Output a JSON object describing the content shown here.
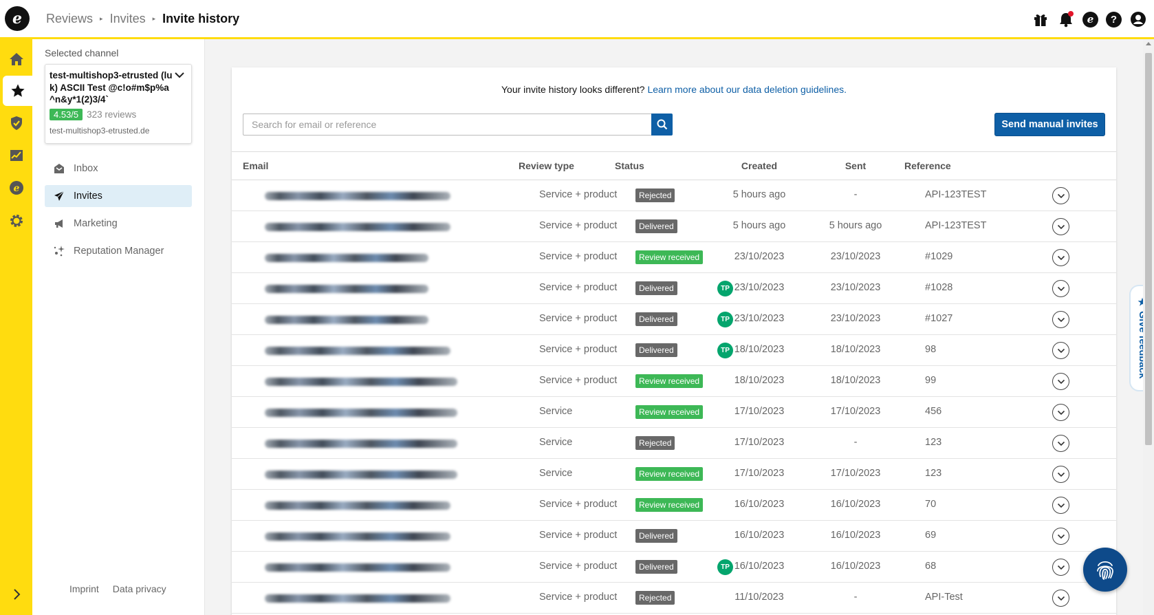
{
  "header": {
    "logo_letter": "e",
    "breadcrumb": [
      "Reviews",
      "Invites",
      "Invite history"
    ],
    "icons": [
      "gift-icon",
      "bell-icon",
      "etrusted-icon",
      "help-icon",
      "user-icon"
    ],
    "notification_dot_color": "#e3152a"
  },
  "rail": {
    "items": [
      "home-icon",
      "star-icon",
      "shield-icon",
      "chart-icon",
      "etrusted-icon",
      "gear-icon"
    ],
    "active": "star-icon",
    "color": "#ffdc0f"
  },
  "sidebar": {
    "selected_label": "Selected channel",
    "channel": {
      "name": "test-multishop3-etrusted (luk) ASCII Test @c!o#m$p%a^n&y*1(2)3/4`",
      "rating": "4.53/5",
      "reviews": "323 reviews",
      "url": "test-multishop3-etrusted.de"
    },
    "nav": [
      {
        "label": "Inbox",
        "icon": "inbox-icon"
      },
      {
        "label": "Invites",
        "icon": "paper-plane-icon"
      },
      {
        "label": "Marketing",
        "icon": "megaphone-icon"
      },
      {
        "label": "Reputation Manager",
        "icon": "sparkle-icon"
      }
    ],
    "footer": {
      "imprint": "Imprint",
      "privacy": "Data privacy"
    }
  },
  "main": {
    "notice_text": "Your invite history looks different?",
    "notice_link": "Learn more about our data deletion guidelines.",
    "search_placeholder": "Search for email or reference",
    "send_button": "Send manual invites",
    "columns": {
      "email": "Email",
      "type": "Review type",
      "status": "Status",
      "created": "Created",
      "sent": "Sent",
      "reference": "Reference"
    },
    "tp_label": "TP",
    "rows": [
      {
        "type": "Service + product",
        "status": "Rejected",
        "tp": false,
        "created": "5 hours ago",
        "sent": "-",
        "reference": "API-123TEST"
      },
      {
        "type": "Service + product",
        "status": "Delivered",
        "tp": false,
        "created": "5 hours ago",
        "sent": "5 hours ago",
        "reference": "API-123TEST"
      },
      {
        "type": "Service + product",
        "status": "Review received",
        "tp": false,
        "created": "23/10/2023",
        "sent": "23/10/2023",
        "reference": "#1029"
      },
      {
        "type": "Service + product",
        "status": "Delivered",
        "tp": true,
        "created": "23/10/2023",
        "sent": "23/10/2023",
        "reference": "#1028"
      },
      {
        "type": "Service + product",
        "status": "Delivered",
        "tp": true,
        "created": "23/10/2023",
        "sent": "23/10/2023",
        "reference": "#1027"
      },
      {
        "type": "Service + product",
        "status": "Delivered",
        "tp": true,
        "created": "18/10/2023",
        "sent": "18/10/2023",
        "reference": "98"
      },
      {
        "type": "Service + product",
        "status": "Review received",
        "tp": false,
        "created": "18/10/2023",
        "sent": "18/10/2023",
        "reference": "99"
      },
      {
        "type": "Service",
        "status": "Review received",
        "tp": false,
        "created": "17/10/2023",
        "sent": "17/10/2023",
        "reference": "456"
      },
      {
        "type": "Service",
        "status": "Rejected",
        "tp": false,
        "created": "17/10/2023",
        "sent": "-",
        "reference": "123"
      },
      {
        "type": "Service",
        "status": "Review received",
        "tp": false,
        "created": "17/10/2023",
        "sent": "17/10/2023",
        "reference": "123"
      },
      {
        "type": "Service + product",
        "status": "Review received",
        "tp": false,
        "created": "16/10/2023",
        "sent": "16/10/2023",
        "reference": "70"
      },
      {
        "type": "Service + product",
        "status": "Delivered",
        "tp": false,
        "created": "16/10/2023",
        "sent": "16/10/2023",
        "reference": "69"
      },
      {
        "type": "Service + product",
        "status": "Delivered",
        "tp": true,
        "created": "16/10/2023",
        "sent": "16/10/2023",
        "reference": "68"
      },
      {
        "type": "Service + product",
        "status": "Rejected",
        "tp": false,
        "created": "11/10/2023",
        "sent": "-",
        "reference": "API-Test"
      }
    ]
  },
  "feedback_label": "★ Give feedback",
  "colors": {
    "accent": "#0e5fa6",
    "green": "#3db856",
    "gray_badge": "#686868",
    "tp": "#04a56d"
  }
}
